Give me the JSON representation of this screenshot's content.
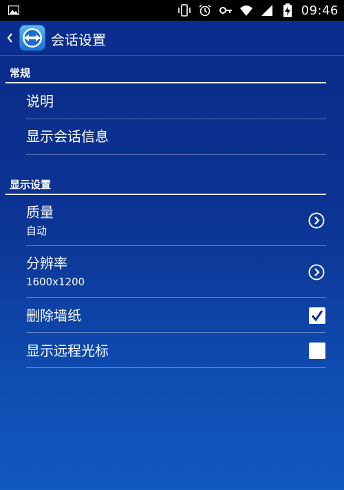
{
  "status_bar": {
    "time": "09:46",
    "icons": [
      "image-icon",
      "vibrate-icon",
      "alarm-icon",
      "key-icon",
      "wifi-icon",
      "signal-icon",
      "battery-charging-icon"
    ]
  },
  "action_bar": {
    "title": "会话设置",
    "icons": [
      "back-chevron-icon",
      "teamviewer-logo-icon"
    ]
  },
  "sections": {
    "general": {
      "header": "常规",
      "items": [
        {
          "title": "说明"
        },
        {
          "title": "显示会话信息"
        }
      ]
    },
    "display": {
      "header": "显示设置",
      "items": [
        {
          "title": "质量",
          "subtitle": "自动",
          "control": "chevron"
        },
        {
          "title": "分辨率",
          "subtitle": "1600x1200",
          "control": "chevron"
        },
        {
          "title": "删除墙纸",
          "control": "checkbox",
          "checked": true
        },
        {
          "title": "显示远程光标",
          "control": "checkbox",
          "checked": false
        }
      ]
    }
  },
  "colors": {
    "background_top": "#0a2a86",
    "background_bottom": "#1259c0",
    "text": "#ffffff"
  }
}
